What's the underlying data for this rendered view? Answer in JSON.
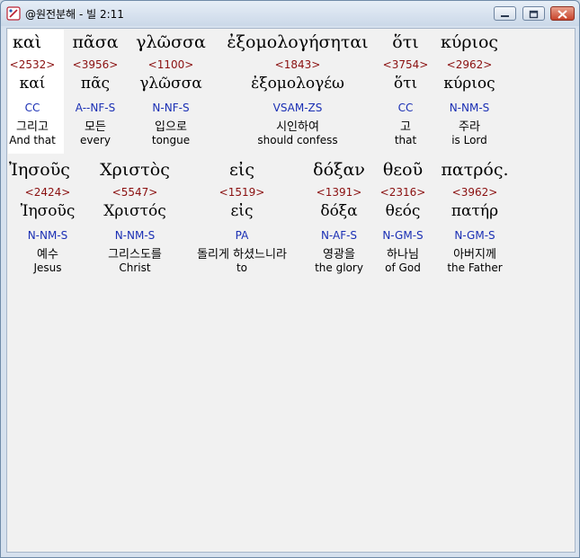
{
  "window": {
    "title": "@원전분해 - 빌 2:11",
    "icon": "app-icon"
  },
  "verse": {
    "row1": [
      {
        "greek": "καὶ",
        "strong": "<2532>",
        "lemma": "καί",
        "morph": "CC",
        "korean": "그리고",
        "english": "And that"
      },
      {
        "greek": "πᾶσα",
        "strong": "<3956>",
        "lemma": "πᾶς",
        "morph": "A--NF-S",
        "korean": "모든",
        "english": "every"
      },
      {
        "greek": "γλῶσσα",
        "strong": "<1100>",
        "lemma": "γλῶσσα",
        "morph": "N-NF-S",
        "korean": "입으로",
        "english": "tongue"
      },
      {
        "greek": "ἐξομολογήσηται",
        "strong": "<1843>",
        "lemma": "ἐξομολογέω",
        "morph": "VSAM-ZS",
        "korean": "시인하여",
        "english": "should confess"
      },
      {
        "greek": "ὅτι",
        "strong": "<3754>",
        "lemma": "ὅτι",
        "morph": "CC",
        "korean": "고",
        "english": "that"
      },
      {
        "greek": "κύριος",
        "strong": "<2962>",
        "lemma": "κύριος",
        "morph": "N-NM-S",
        "korean": "주라",
        "english": "is Lord"
      }
    ],
    "row2": [
      {
        "greek": "Ἰησοῦς",
        "strong": "<2424>",
        "lemma": "Ἰησοῦς",
        "morph": "N-NM-S",
        "korean": "예수",
        "english": "Jesus"
      },
      {
        "greek": "Χριστὸς",
        "strong": "<5547>",
        "lemma": "Χριστός",
        "morph": "N-NM-S",
        "korean": "그리스도를",
        "english": "Christ"
      },
      {
        "greek": "εἰς",
        "strong": "<1519>",
        "lemma": "εἰς",
        "morph": "PA",
        "korean": "돌리게 하셨느니라",
        "english": "to"
      },
      {
        "greek": "δόξαν",
        "strong": "<1391>",
        "lemma": "δόξα",
        "morph": "N-AF-S",
        "korean": "영광을",
        "english": "the glory"
      },
      {
        "greek": "θεοῦ",
        "strong": "<2316>",
        "lemma": "θεός",
        "morph": "N-GM-S",
        "korean": "하나님",
        "english": "of God"
      },
      {
        "greek": "πατρός.",
        "strong": "<3962>",
        "lemma": "πατήρ",
        "morph": "N-GM-S",
        "korean": "아버지께",
        "english": "the Father"
      }
    ]
  },
  "colors": {
    "strong": "#8a1010",
    "morph": "#1a2fb4",
    "selected_background": "#ffffff"
  }
}
